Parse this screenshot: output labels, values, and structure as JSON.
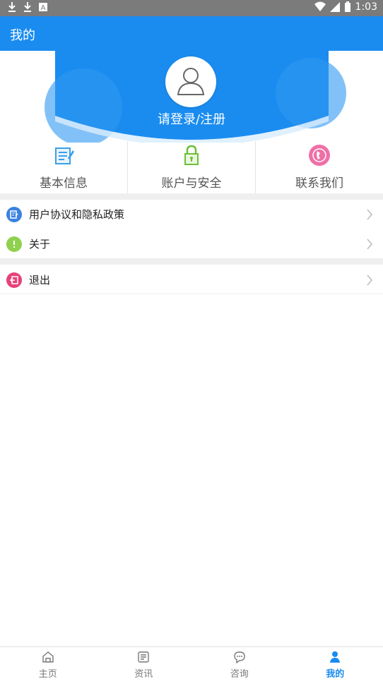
{
  "status_bar": {
    "time": "1:03",
    "left_icons": [
      "download-icon",
      "download-icon",
      "notification-a-icon"
    ],
    "right_icons": [
      "wifi-icon",
      "signal-icon",
      "battery-icon"
    ]
  },
  "app_bar": {
    "title": "我的"
  },
  "profile": {
    "login_text": "请登录/注册"
  },
  "quick_actions": [
    {
      "label": "基本信息",
      "icon": "edit-document-icon",
      "color": "#3aa0e8"
    },
    {
      "label": "账户与安全",
      "icon": "lock-icon",
      "color": "#6dbf3a"
    },
    {
      "label": "联系我们",
      "icon": "phone-icon",
      "color": "#f06fa6"
    }
  ],
  "menu": [
    {
      "label": "用户协议和隐私政策",
      "icon": "document-icon",
      "color": "#3b82e0"
    },
    {
      "label": "关于",
      "icon": "info-icon",
      "color": "#8fd14f"
    },
    {
      "label": "退出",
      "icon": "logout-icon",
      "color": "#e8417a"
    }
  ],
  "tabs": [
    {
      "label": "主页",
      "icon": "home-icon",
      "active": false
    },
    {
      "label": "资讯",
      "icon": "news-icon",
      "active": false
    },
    {
      "label": "咨询",
      "icon": "chat-icon",
      "active": false
    },
    {
      "label": "我的",
      "icon": "user-icon",
      "active": true
    }
  ],
  "colors": {
    "primary": "#1a8cf0",
    "status_bar": "#7b7b7b"
  }
}
